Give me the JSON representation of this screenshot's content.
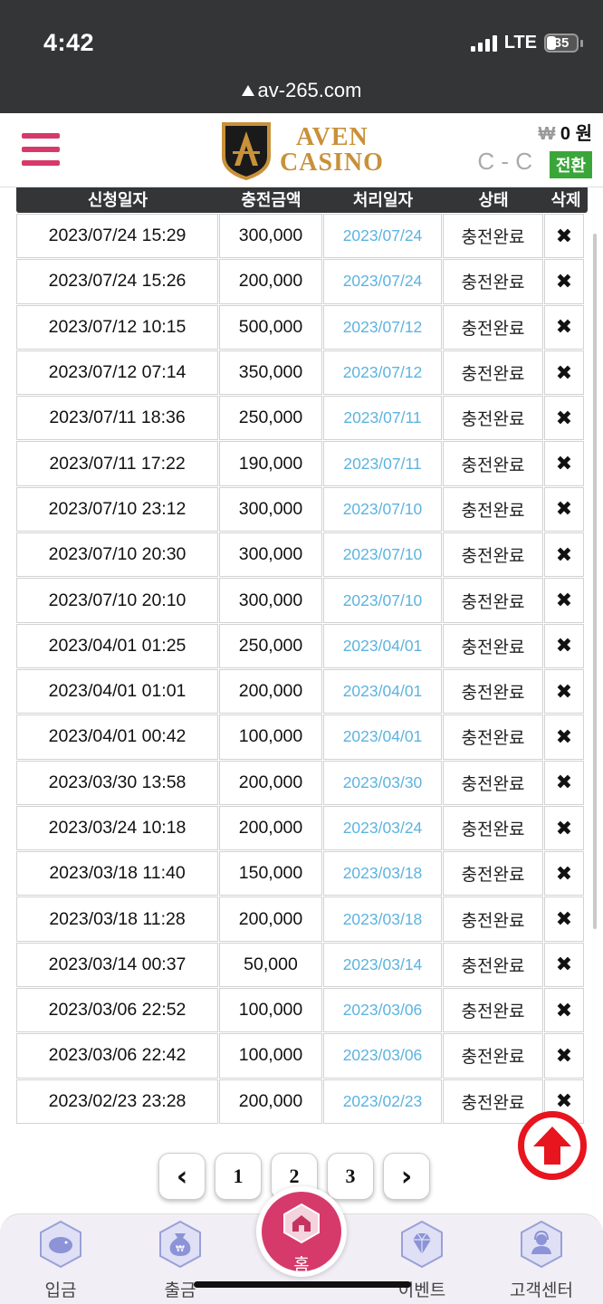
{
  "status_bar": {
    "time": "4:42",
    "network": "LTE",
    "battery": "35",
    "url": "av-265.com"
  },
  "header": {
    "logo_line1": "AVEN",
    "logo_line2": "CASINO",
    "balance_symbol": "₩",
    "balance_value": "0",
    "balance_unit": "원",
    "reload_text": "C - C",
    "convert_label": "전환"
  },
  "table": {
    "columns": [
      "신청일자",
      "충전금액",
      "처리일자",
      "상태",
      "삭제"
    ],
    "rows": [
      {
        "date": "2023/07/24 15:29",
        "amount": "300,000",
        "processed": "2023/07/24",
        "status": "충전완료"
      },
      {
        "date": "2023/07/24 15:26",
        "amount": "200,000",
        "processed": "2023/07/24",
        "status": "충전완료"
      },
      {
        "date": "2023/07/12 10:15",
        "amount": "500,000",
        "processed": "2023/07/12",
        "status": "충전완료"
      },
      {
        "date": "2023/07/12 07:14",
        "amount": "350,000",
        "processed": "2023/07/12",
        "status": "충전완료"
      },
      {
        "date": "2023/07/11 18:36",
        "amount": "250,000",
        "processed": "2023/07/11",
        "status": "충전완료"
      },
      {
        "date": "2023/07/11 17:22",
        "amount": "190,000",
        "processed": "2023/07/11",
        "status": "충전완료"
      },
      {
        "date": "2023/07/10 23:12",
        "amount": "300,000",
        "processed": "2023/07/10",
        "status": "충전완료"
      },
      {
        "date": "2023/07/10 20:30",
        "amount": "300,000",
        "processed": "2023/07/10",
        "status": "충전완료"
      },
      {
        "date": "2023/07/10 20:10",
        "amount": "300,000",
        "processed": "2023/07/10",
        "status": "충전완료"
      },
      {
        "date": "2023/04/01 01:25",
        "amount": "250,000",
        "processed": "2023/04/01",
        "status": "충전완료"
      },
      {
        "date": "2023/04/01 01:01",
        "amount": "200,000",
        "processed": "2023/04/01",
        "status": "충전완료"
      },
      {
        "date": "2023/04/01 00:42",
        "amount": "100,000",
        "processed": "2023/04/01",
        "status": "충전완료"
      },
      {
        "date": "2023/03/30 13:58",
        "amount": "200,000",
        "processed": "2023/03/30",
        "status": "충전완료"
      },
      {
        "date": "2023/03/24 10:18",
        "amount": "200,000",
        "processed": "2023/03/24",
        "status": "충전완료"
      },
      {
        "date": "2023/03/18 11:40",
        "amount": "150,000",
        "processed": "2023/03/18",
        "status": "충전완료"
      },
      {
        "date": "2023/03/18 11:28",
        "amount": "200,000",
        "processed": "2023/03/18",
        "status": "충전완료"
      },
      {
        "date": "2023/03/14 00:37",
        "amount": "50,000",
        "processed": "2023/03/14",
        "status": "충전완료"
      },
      {
        "date": "2023/03/06 22:52",
        "amount": "100,000",
        "processed": "2023/03/06",
        "status": "충전완료"
      },
      {
        "date": "2023/03/06 22:42",
        "amount": "100,000",
        "processed": "2023/03/06",
        "status": "충전완료"
      },
      {
        "date": "2023/02/23 23:28",
        "amount": "200,000",
        "processed": "2023/02/23",
        "status": "충전완료"
      }
    ],
    "delete_symbol": "✖"
  },
  "pagination": {
    "prev": "‹",
    "pages": [
      "1",
      "2",
      "3"
    ],
    "next": "›"
  },
  "bottom_nav": {
    "deposit": "입금",
    "withdraw": "출금",
    "home": "홈",
    "event": "이벤트",
    "support": "고객센터"
  },
  "colors": {
    "brand_pink": "#d63a6a",
    "gold": "#c8913a",
    "convert_green": "#3aa63a",
    "date_link": "#5cb3e0",
    "to_top_red": "#e8141e"
  }
}
